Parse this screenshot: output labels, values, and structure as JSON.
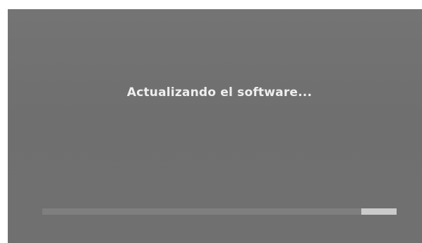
{
  "screen": {
    "message": "Actualizando el software..."
  },
  "progress": {
    "indicator": "indeterminate",
    "track_color": "#7f7f7f",
    "fill_color": "#cbcbcb"
  },
  "colors": {
    "background": "#717171",
    "text": "#eeeeee"
  }
}
